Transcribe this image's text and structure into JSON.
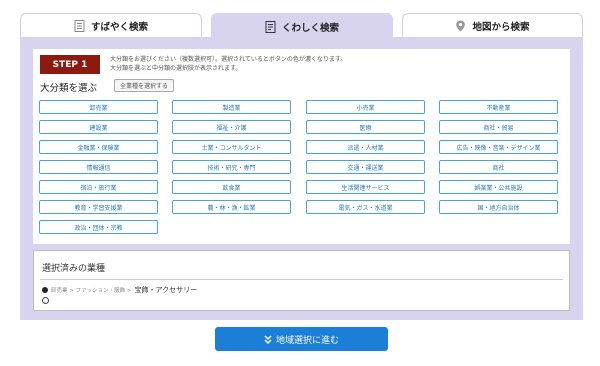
{
  "tabs": [
    {
      "label": "すばやく検索",
      "icon": "list-icon"
    },
    {
      "label": "くわしく検索",
      "icon": "detail-list-icon"
    },
    {
      "label": "地図から検索",
      "icon": "map-pin-icon"
    }
  ],
  "step": {
    "badge": "STEP 1",
    "heading": "大分類を選ぶ",
    "select_all": "全業種を選択する",
    "desc_line1": "大分類をお選びください（複数選択可）。選択されているとボタンの色が濃くなります。",
    "desc_line2": "大分類を選ぶと中分類の選択肢が表示されます。"
  },
  "categories": [
    "卸売業",
    "製造業",
    "小売業",
    "不動産業",
    "建設業",
    "福祉・介護",
    "医療",
    "商社・貿易",
    "金融業・保険業",
    "士業・コンサルタント",
    "派遣・人材業",
    "広告・映像・音楽・デザイン業",
    "情報通信",
    "技術・研究・専門",
    "交通・運送業",
    "商社",
    "宿泊・旅行業",
    "飲食業",
    "生活関連サービス",
    "娯楽業・公共施設",
    "教育・学習支援業",
    "農・林・漁・鉱業",
    "電気・ガス・水道業",
    "国・地方自治体",
    "政治・団体・宗教"
  ],
  "selected": {
    "title": "選択済みの業種",
    "path": "卸売業 > ファッション・服飾 >",
    "item": "宝飾・アクセサリー"
  },
  "next_button": {
    "label": "地域選択に進む",
    "icon": "double-chevron-down-icon"
  },
  "colors": {
    "accent": "#1b7fd8",
    "panel": "#d8d4f0",
    "badge": "#8b1a10",
    "category_border": "#4aa3e0"
  }
}
